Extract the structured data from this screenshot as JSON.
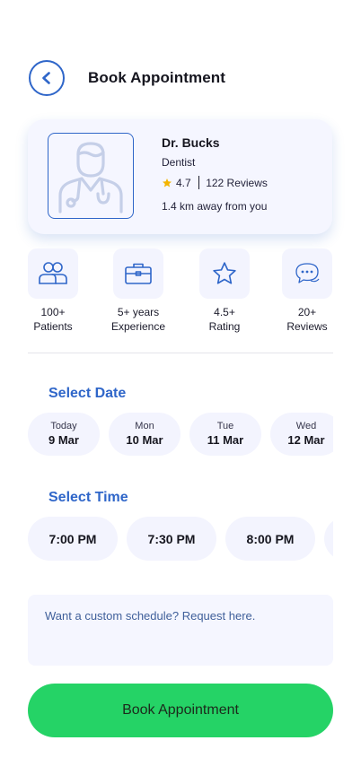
{
  "header": {
    "title": "Book Appointment",
    "back_icon": "chevron-left-icon"
  },
  "doctor": {
    "name": "Dr. Bucks",
    "specialty": "Dentist",
    "rating": "4.7",
    "reviews": "122 Reviews",
    "distance": "1.4 km away from you",
    "photo_icon": "doctor-avatar-icon"
  },
  "stats": [
    {
      "icon": "patients-icon",
      "line1": "100+",
      "line2": "Patients"
    },
    {
      "icon": "briefcase-icon",
      "line1": "5+ years",
      "line2": "Experience"
    },
    {
      "icon": "star-icon",
      "line1": "4.5+",
      "line2": "Rating"
    },
    {
      "icon": "chat-bubble-icon",
      "line1": "20+",
      "line2": "Reviews"
    }
  ],
  "select_date": {
    "title": "Select Date",
    "dates": [
      {
        "day": "Today",
        "date": "9 Mar"
      },
      {
        "day": "Mon",
        "date": "10 Mar"
      },
      {
        "day": "Tue",
        "date": "11 Mar"
      },
      {
        "day": "Wed",
        "date": "12 Mar"
      }
    ]
  },
  "select_time": {
    "title": "Select Time",
    "times": [
      "7:00 PM",
      "7:30 PM",
      "8:00 PM",
      ""
    ]
  },
  "custom_schedule": {
    "text": "Want a custom schedule? Request here."
  },
  "book_button": {
    "label": "Book Appointment"
  },
  "colors": {
    "accent": "#2f66c9",
    "primary_button": "#25d366",
    "card_bg": "#f5f6ff",
    "star": "#f4b400"
  }
}
